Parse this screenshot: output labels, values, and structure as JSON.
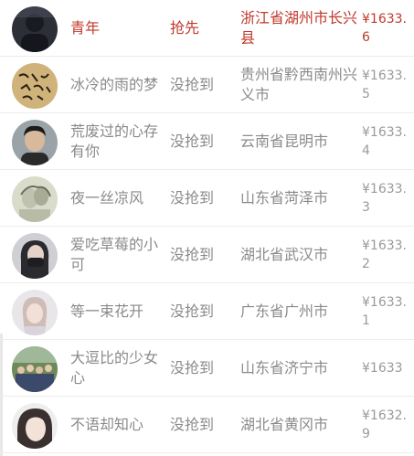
{
  "accent_color": "#c0392b",
  "text_color": "#8a8a8a",
  "rows": [
    {
      "name": "青年",
      "status": "抢先",
      "location": "浙江省湖州市长兴县",
      "amount": "¥1633.6",
      "winner": true,
      "avatar": "avatar-dark-silhouette"
    },
    {
      "name": "冰冷的雨的梦",
      "status": "没抢到",
      "location": "贵州省黔西南州兴义市",
      "amount": "¥1633.5",
      "winner": false,
      "avatar": "avatar-calligraphy"
    },
    {
      "name": "荒废过的心存有你",
      "status": "没抢到",
      "location": "云南省昆明市",
      "amount": "¥1633.4",
      "winner": false,
      "avatar": "avatar-man-portrait"
    },
    {
      "name": "夜一丝凉风",
      "status": "没抢到",
      "location": "山东省菏泽市",
      "amount": "¥1633.3",
      "winner": false,
      "avatar": "avatar-couple-sketch"
    },
    {
      "name": "爱吃草莓的小可",
      "status": "没抢到",
      "location": "湖北省武汉市",
      "amount": "¥1633.2",
      "winner": false,
      "avatar": "avatar-masked-girl"
    },
    {
      "name": "等一束花开",
      "status": "没抢到",
      "location": "广东省广州市",
      "amount": "¥1633.1",
      "winner": false,
      "avatar": "avatar-girl-portrait"
    },
    {
      "name": "大逗比的少女心",
      "status": "没抢到",
      "location": "山东省济宁市",
      "amount": "¥1633",
      "winner": false,
      "avatar": "avatar-group-photo"
    },
    {
      "name": "不语却知心",
      "status": "没抢到",
      "location": "湖北省黄冈市",
      "amount": "¥1632.9",
      "winner": false,
      "avatar": "avatar-girl-face"
    }
  ]
}
